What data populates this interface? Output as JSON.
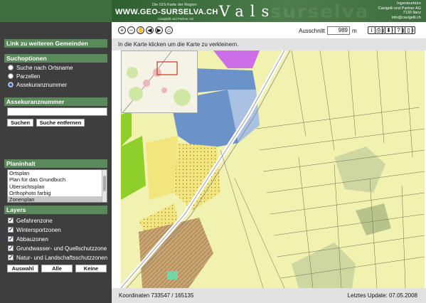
{
  "header": {
    "tagline": "Die GIS-Karte der Region",
    "site_url": "WWW.GEO-SURSELVA.CH",
    "sub_tagline": "Caviglelli und Partner AG",
    "ghost_text": "surselva",
    "app_title": "Vals",
    "company_lines": [
      "Ingenieurbüro",
      "Cavigelli und Partner AG",
      "7130 Ilanz",
      "info@cavigelli.ch"
    ]
  },
  "sidebar": {
    "link_label": "Link zu weiteren Gemeinden",
    "search_options_title": "Suchoptionen",
    "search_options": [
      {
        "label": "Suche nach Ortsname",
        "checked": false
      },
      {
        "label": "Parzellen",
        "checked": false
      },
      {
        "label": "Assekuranznummer",
        "checked": true
      }
    ],
    "field_title": "Assekuranznummer",
    "field_value": "",
    "search_button": "Suchen",
    "clear_button": "Suche entfernen",
    "planinhalt_title": "Planinhalt",
    "planinhalt_items": [
      "Ortsplan",
      "Plan für das Grundbuch",
      "Übersichtsplan",
      "Orthophoto farbig",
      "Zonenplan"
    ],
    "planinhalt_selected": "Zonenplan",
    "layers_title": "Layers",
    "layers": [
      {
        "label": "Gefahrenzone",
        "checked": true
      },
      {
        "label": "Wintersportzonen",
        "checked": true
      },
      {
        "label": "Abbauzonen",
        "checked": true
      },
      {
        "label": "Grundwasser- und Quellschutzzone",
        "checked": true
      },
      {
        "label": "Natur- und Landschaftsschutzzonen",
        "checked": true
      }
    ],
    "select_button": "Auswahl",
    "all_button": "Alle",
    "none_button": "Keine"
  },
  "toolbar": {
    "scale_label": "Ausschnitt",
    "scale_value": "989",
    "scale_unit": "m",
    "left_icons": [
      "zoom-in-icon",
      "zoom-out-icon",
      "pan-icon",
      "back-icon",
      "forward-icon",
      "home-icon"
    ],
    "right_icons_group1": [
      "info-icon",
      "document-icon",
      "list-icon",
      "layers-icon",
      "measure-icon"
    ],
    "right_icons_group2": [
      "print-icon",
      "download-icon",
      "help-icon",
      "file-icon"
    ]
  },
  "instruction": "In die Karte klicken um die Karte zu verkleinern.",
  "status": {
    "coords_label": "Koordinaten",
    "coords_value": "733547 / 165135",
    "update_label": "Letztes Update:",
    "update_value": "07.05.2008"
  },
  "map_colors": {
    "agriculture": "#f1f1b0",
    "forest": "#cfd7a0",
    "forest_dark": "#b8c38a",
    "residential": "#f3e57e",
    "public": "#6b93c9",
    "public_light": "#a9c1e3",
    "commercial": "#cb6ee8",
    "core": "#c8a472",
    "green": "#8fcf2c",
    "road": "#ffffff"
  }
}
